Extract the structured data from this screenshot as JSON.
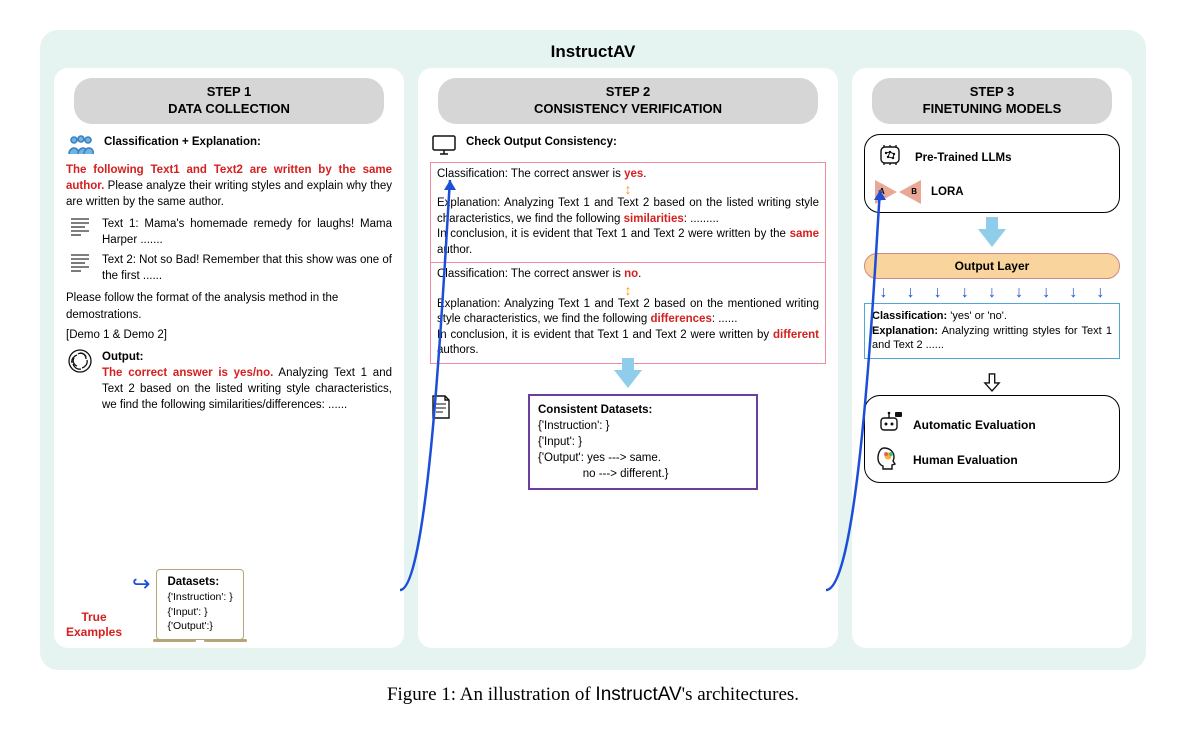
{
  "title": "InstructAV",
  "caption_prefix": "Figure 1: An illustration of ",
  "caption_name": "InstructAV",
  "caption_suffix": "'s architectures.",
  "step1": {
    "header": "STEP 1\nDATA COLLECTION",
    "heading": "Classification + Explanation:",
    "prompt_red": "The following Text1 and Text2 are written by the same author.",
    "prompt_rest": " Please analyze their writing styles and explain why they are written by the same author.",
    "text1_label": "Text 1:",
    "text1_body": " Mama's homemade remedy for laughs! Mama Harper .......",
    "text2_label": "Text 2:",
    "text2_body": "  Not so Bad! Remember that this show was one of the first ......",
    "follow": "Please follow the format of the analysis method in the demostrations.",
    "demos": "[Demo 1 & Demo 2]",
    "output_label": "Output:",
    "output_red": "The correct answer is yes/no.",
    "output_rest": " Analyzing Text 1 and Text 2 based on the listed writing style characteristics, we find the following similarities/differences: ......",
    "true_examples": "True Examples",
    "datasets_title": "Datasets:",
    "datasets_lines": [
      "{'Instruction': }",
      "{'Input': }",
      "{'Output':}"
    ]
  },
  "step2": {
    "header": "STEP 2\nCONSISTENCY VERIFICATION",
    "heading": "Check Output Consistency:",
    "yes_class_pre": "Classification: The correct answer is ",
    "yes_class_ans": "yes",
    "yes_expl_pre": "Explanation: Analyzing Text 1 and Text 2 based on the listed writing style characteristics, we find the following ",
    "yes_expl_key": "similarities",
    "yes_expl_post": ": .........",
    "yes_concl_pre": "In conclusion, it is evident that Text 1 and Text 2 were written by the ",
    "yes_concl_key": "same",
    "yes_concl_post": " author.",
    "no_class_pre": "Classification: The correct answer is ",
    "no_class_ans": "no",
    "no_expl_pre": "Explanation: Analyzing Text 1 and Text 2 based on the mentioned writing style characteristics, we find the following ",
    "no_expl_key": "differences",
    "no_expl_post": ": ......",
    "no_concl_pre": "In conclusion, it is evident that Text 1 and Text 2 were written by ",
    "no_concl_key": "different",
    "no_concl_post": " authors.",
    "cd_title": "Consistent Datasets:",
    "cd_lines": [
      "{'Instruction': }",
      "{'Input': }",
      "{'Output': yes ---> same.",
      "              no ---> different.}"
    ]
  },
  "step3": {
    "header": "STEP 3\nFINETUNING MODELS",
    "llm": "Pre-Trained LLMs",
    "lora": "LORA",
    "output_layer": "Output Layer",
    "class_line1a": "Classification:",
    "class_line1b": " 'yes' or 'no'.",
    "class_line2a": "Explanation:",
    "class_line2b": " Analyzing writting styles for Text 1 and Text 2 ......",
    "auto_eval": "Automatic Evaluation",
    "human_eval": "Human Evaluation"
  }
}
